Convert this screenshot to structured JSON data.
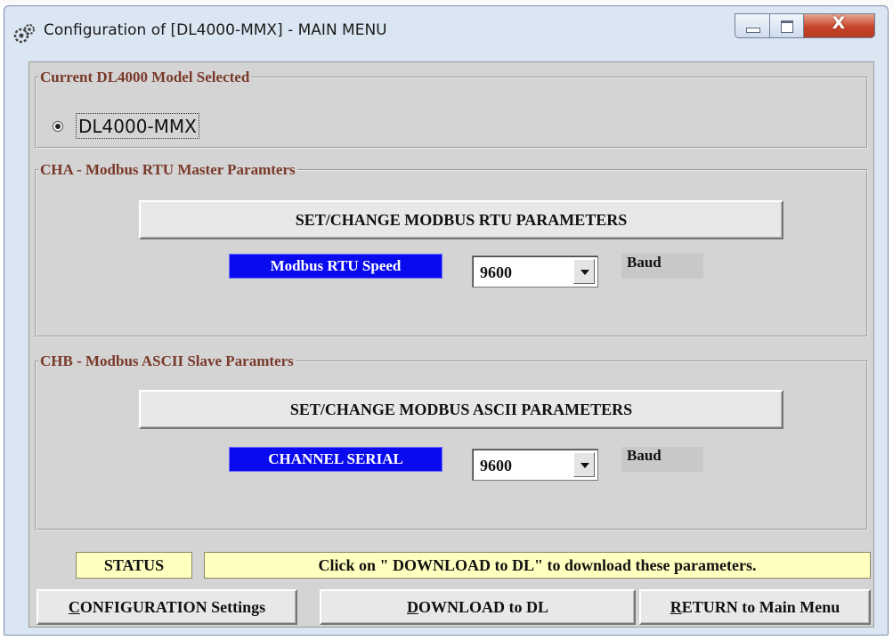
{
  "window": {
    "title": "Configuration of [DL4000-MMX] - MAIN MENU",
    "close_glyph": "X",
    "icons": [
      "app-config-icon",
      "minimize-icon",
      "maximize-icon",
      "close-icon"
    ]
  },
  "model_section": {
    "legend": "Current DL4000 Model Selected",
    "selected_model": "DL4000-MMX"
  },
  "cha_section": {
    "legend": "CHA - Modbus RTU Master Paramters",
    "set_button": "SET/CHANGE MODBUS RTU PARAMETERS",
    "speed_label": "Modbus RTU Speed",
    "speed_value": "9600",
    "unit": "Baud"
  },
  "chb_section": {
    "legend": "CHB - Modbus ASCII Slave Paramters",
    "set_button": "SET/CHANGE MODBUS ASCII PARAMETERS",
    "speed_label": "CHANNEL SERIAL",
    "speed_value": "9600",
    "unit": "Baud"
  },
  "status": {
    "label": "STATUS",
    "message": "Click on \" DOWNLOAD to DL\"  to download these parameters."
  },
  "buttons": {
    "config": {
      "mnemonic": "C",
      "rest": "ONFIGURATION Settings"
    },
    "download": {
      "mnemonic": "D",
      "rest": "OWNLOAD to DL"
    },
    "return": {
      "mnemonic": "R",
      "rest": "ETURN to Main Menu"
    }
  },
  "colors": {
    "legend_text": "#7a3a2a",
    "blue_label": "#0a0aee",
    "status_bg": "#ffffbf",
    "client_bg": "#d4d4d4",
    "frame": "#dbe6f3"
  }
}
